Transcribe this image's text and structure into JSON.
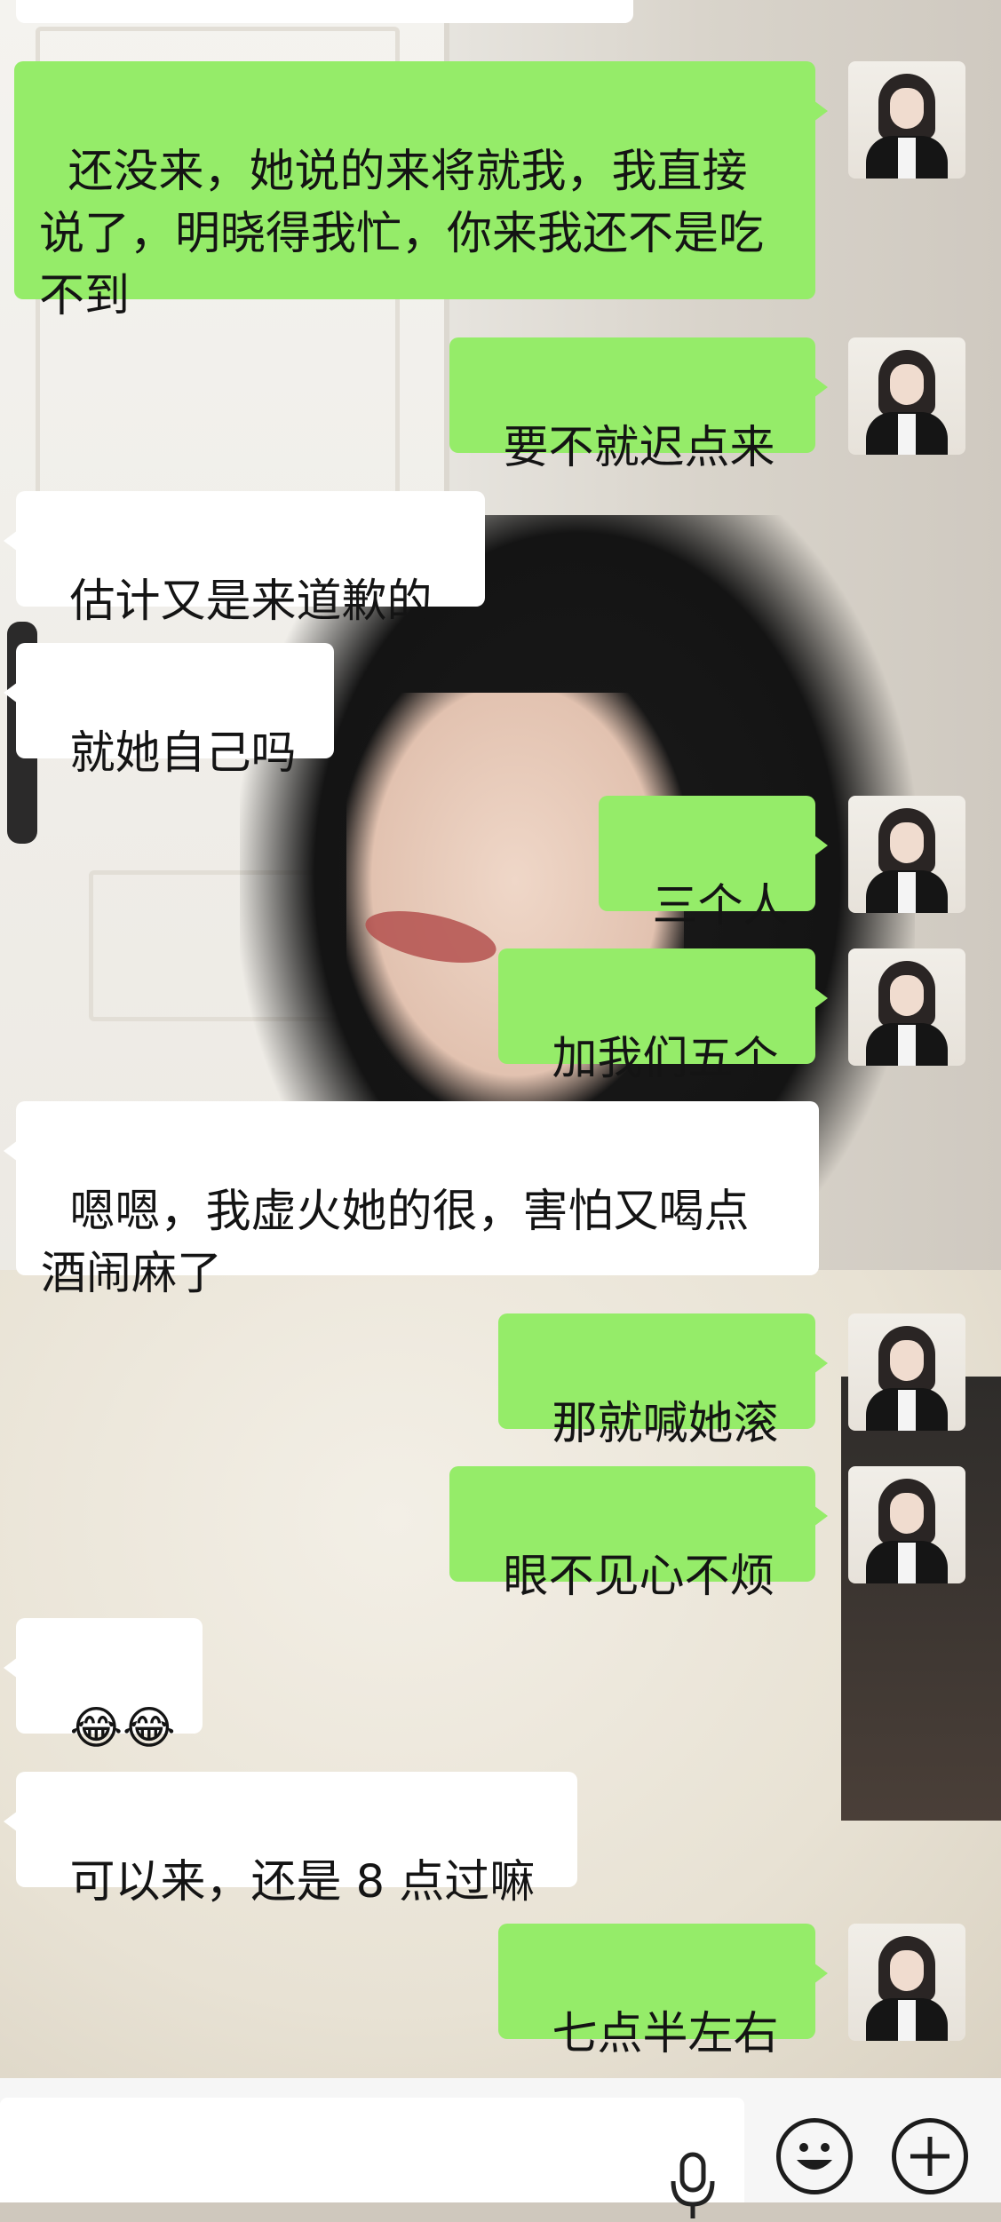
{
  "messages": [
    {
      "side": "me",
      "text": "还没来，她说的来将就我，我直接说了，明晓得我忙，你来我还不是吃不到"
    },
    {
      "side": "me",
      "text": "要不就迟点来"
    },
    {
      "side": "them",
      "text": "估计又是来道歉的"
    },
    {
      "side": "them",
      "text": "就她自己吗"
    },
    {
      "side": "me",
      "text": "三个人"
    },
    {
      "side": "me",
      "text": "加我们五个"
    },
    {
      "side": "them",
      "text": "嗯嗯，我虚火她的很，害怕又喝点酒闹麻了"
    },
    {
      "side": "me",
      "text": "那就喊她滚"
    },
    {
      "side": "me",
      "text": "眼不见心不烦"
    },
    {
      "side": "them",
      "text": "😂😂"
    },
    {
      "side": "them",
      "text": "可以来，还是 8 点过嘛"
    },
    {
      "side": "me",
      "text": "七点半左右"
    }
  ],
  "input_bar": {
    "placeholder": "",
    "icons": [
      "microphone-icon",
      "emoji-icon",
      "plus-icon"
    ]
  },
  "colors": {
    "sent_bubble": "#95ec69",
    "received_bubble": "#ffffff",
    "input_bar": "#f6f6f6"
  }
}
